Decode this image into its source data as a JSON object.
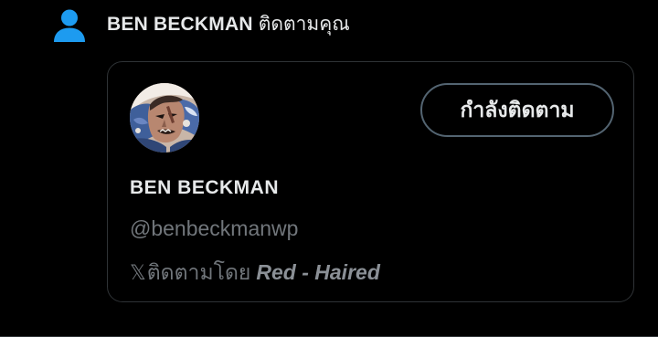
{
  "notification": {
    "icon": "person-icon",
    "actor_name": "BEN BECKMAN",
    "action_text": "ติดตามคุณ"
  },
  "user_card": {
    "avatar_icon": "avatar",
    "follow_button_label": "กำลังติดตาม",
    "display_name": "BEN BECKMAN",
    "handle": "@benbeckmanwp",
    "followed_by_glyph": "𝕏",
    "followed_by_prefix": "ติดตามโดย",
    "followed_by_name": "Red - Haired"
  },
  "colors": {
    "background": "#000000",
    "icon_blue": "#1d9bf0",
    "primary_text": "#e7e9ea",
    "secondary_text": "#71767b",
    "border": "#2f3336"
  }
}
